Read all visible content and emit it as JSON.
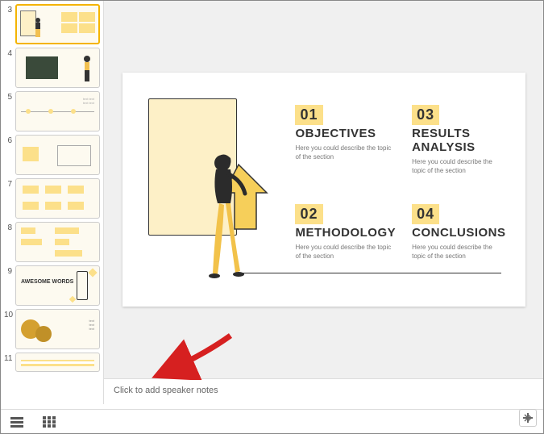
{
  "sidebar": {
    "thumbs": [
      {
        "num": "3"
      },
      {
        "num": "4"
      },
      {
        "num": "5"
      },
      {
        "num": "6"
      },
      {
        "num": "7"
      },
      {
        "num": "8"
      },
      {
        "num": "9",
        "label": "AWESOME WORDS"
      },
      {
        "num": "10"
      },
      {
        "num": "11"
      }
    ]
  },
  "slide": {
    "sections": [
      {
        "num": "01",
        "title": "OBJECTIVES",
        "desc": "Here you could describe the topic of the section"
      },
      {
        "num": "03",
        "title": "RESULTS ANALYSIS",
        "desc": "Here you could describe the topic of the section"
      },
      {
        "num": "02",
        "title": "METHODOLOGY",
        "desc": "Here you could describe the topic of the section"
      },
      {
        "num": "04",
        "title": "CONCLUSIONS",
        "desc": "Here you could describe the topic of the section"
      }
    ]
  },
  "notes": {
    "placeholder": "Click to add speaker notes"
  }
}
